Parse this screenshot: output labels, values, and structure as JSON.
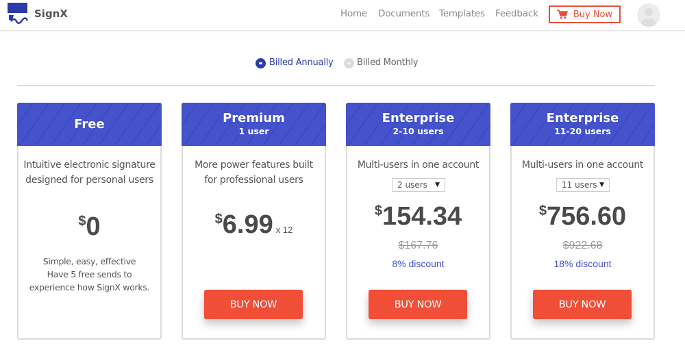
{
  "header": {
    "brand": "SignX",
    "nav": [
      "Home",
      "Documents",
      "Templates",
      "Feedback"
    ],
    "buy_now": "Buy Now",
    "colors": {
      "accent": "#e84e3a",
      "brand": "#2b3aa8"
    }
  },
  "billing": {
    "annual_label": "Billed Annually",
    "monthly_label": "Billed Monthly",
    "selected": "annual"
  },
  "plans": [
    {
      "name": "Free",
      "subtitle": "",
      "description": "Intuitive electronic signature designed for personal users",
      "currency": "$",
      "price": "0",
      "note_lines": [
        "Simple, easy, effective",
        "Have 5 free sends to",
        "experience how SignX works."
      ]
    },
    {
      "name": "Premium",
      "subtitle": "1 user",
      "description": "More power features built for professional users",
      "currency": "$",
      "price": "6.99",
      "multiplier": "x 12",
      "button": "BUY NOW"
    },
    {
      "name": "Enterprise",
      "subtitle": "2-10 users",
      "description": "Multi-users in one account",
      "users_select": "2 users",
      "currency": "$",
      "price": "154.34",
      "old_price": "$167.76",
      "discount": "8% discount",
      "button": "BUY NOW"
    },
    {
      "name": "Enterprise",
      "subtitle": "11-20 users",
      "description": "Multi-users in one account",
      "users_select": "11 users",
      "currency": "$",
      "price": "756.60",
      "old_price": "$922.68",
      "discount": "18% discount",
      "button": "BUY NOW"
    }
  ],
  "select_arrow": "▼"
}
